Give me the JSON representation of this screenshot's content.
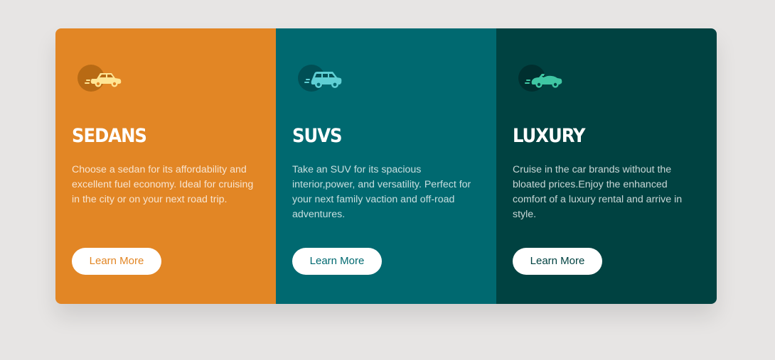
{
  "cards": [
    {
      "title": "Sedans",
      "description": "Choose a sedan for its affordability and excellent fuel economy. Ideal for cruising in the city or on your next road trip.",
      "button_label": "Learn More",
      "icon": "sedan-icon",
      "background_color": "#e28625",
      "icon_color": "#ffe594",
      "icon_circle_color": "#b86a14",
      "button_text_color": "#e28625"
    },
    {
      "title": "SUVs",
      "description": "Take an SUV for its spacious interior,power, and versatility. Perfect for your next family vaction and off-road adventures.",
      "button_label": "Learn More",
      "icon": "suv-icon",
      "background_color": "#006970",
      "icon_color": "#5fcfd4",
      "icon_circle_color": "#004f55",
      "button_text_color": "#006970"
    },
    {
      "title": "Luxury",
      "description": "Cruise in the car brands without the bloated prices.Enjoy the enhanced comfort of a luxury rental and arrive in style.",
      "button_label": "Learn More",
      "icon": "luxury-car-icon",
      "background_color": "#004241",
      "icon_color": "#3fc6a3",
      "icon_circle_color": "#002f2f",
      "button_text_color": "#004241"
    }
  ]
}
